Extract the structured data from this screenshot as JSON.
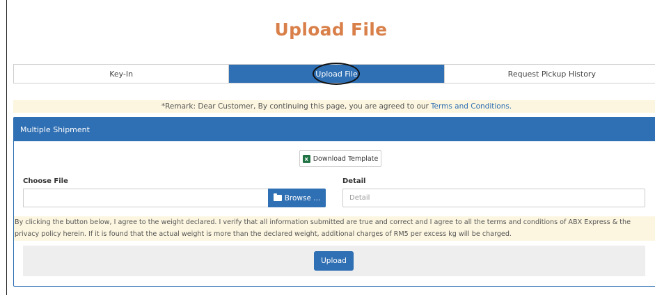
{
  "page": {
    "title": "Upload File"
  },
  "tabs": [
    {
      "label": "Key-In",
      "active": false
    },
    {
      "label": "Upload File",
      "active": true
    },
    {
      "label": "Request Pickup History",
      "active": false
    }
  ],
  "remark": {
    "text": "*Remark: Dear Customer, By continuing this page, you are agreed to our",
    "link": "Terms and Conditions."
  },
  "panel": {
    "title": "Multiple Shipment",
    "download_label": "Download Template",
    "xls_icon_glyph": "x",
    "choose_file_label": "Choose File",
    "file_value": "",
    "browse_label": "Browse ...",
    "detail_label": "Detail",
    "detail_placeholder": "Detail",
    "detail_value": "",
    "agreement_line1": "By clicking the button below, I agree to the weight declared. I verify that all information submitted are true and correct and I agree to all the terms and conditions of ABX Express & the",
    "agreement_line2": "privacy policy herein. If it is found that the actual weight is more than the declared weight, additional charges of RM5 per excess kg will be charged.",
    "upload_label": "Upload"
  },
  "colors": {
    "accent": "#2f6fb3",
    "title": "#d9804a",
    "notice_bg": "#fcf6e0"
  }
}
